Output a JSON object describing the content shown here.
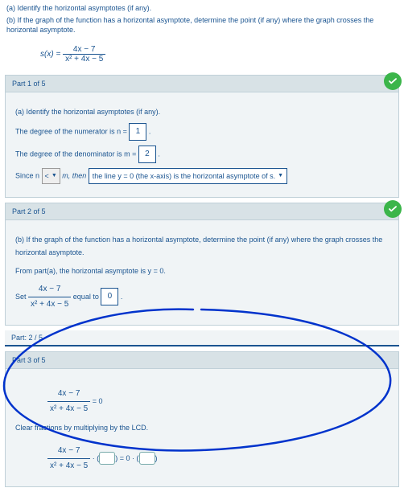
{
  "header": {
    "line_a": "(a) Identify the horizontal asymptotes (if any).",
    "line_b": "(b) If the graph of the function has a horizontal asymptote, determine the point (if any) where the graph crosses the horizontal asymptote."
  },
  "main_eq": {
    "lhs": "s(x) =",
    "num": "4x − 7",
    "den": "x² + 4x − 5"
  },
  "part1": {
    "title": "Part 1 of 5",
    "intro": "(a) Identify the horizontal asymptotes (if any).",
    "numerator_text_pre": "The degree of the numerator is n =",
    "numerator_val": "1",
    "numerator_text_post": ".",
    "denominator_text_pre": "The degree of the denominator is m =",
    "denominator_val": "2",
    "denominator_text_post": ".",
    "since_pre": "Since n",
    "since_op": "<",
    "since_mid": "m, then",
    "since_result": "the line y = 0 (the x-axis) is the horizontal asymptote of s.",
    "dropdown_arrow": "▼"
  },
  "part2": {
    "title": "Part 2 of 5",
    "intro": "(b) If the graph of the function has a horizontal asymptote, determine the point (if any) where the graph crosses the horizontal asymptote.",
    "from_part_a": "From part(a), the horizontal asymptote is y = 0.",
    "set_label": "Set",
    "frac_num": "4x − 7",
    "frac_den": "x² + 4x − 5",
    "equal_to": "equal to",
    "equal_val": "0",
    "period": "."
  },
  "progress": {
    "label": "Part: 2 / 5"
  },
  "part3": {
    "title": "Part 3 of 5",
    "eq1_num": "4x − 7",
    "eq1_den": "x² + 4x − 5",
    "eq1_rhs": "= 0",
    "clear_text": "Clear fractions by multiplying by the LCD.",
    "eq2_num": "4x − 7",
    "eq2_den": "x² + 4x − 5",
    "eq2_dot": "·",
    "eq2_eq": "= 0 ·"
  },
  "icons": {
    "check": "check-icon"
  }
}
